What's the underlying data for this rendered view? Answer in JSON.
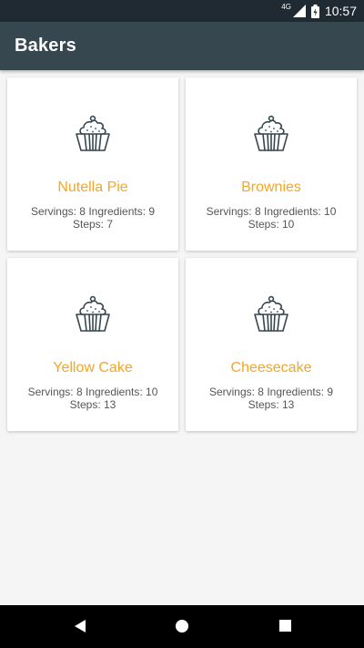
{
  "status_bar": {
    "network": "4G",
    "time": "10:57",
    "icons": [
      "signal-icon",
      "battery-icon"
    ]
  },
  "app_bar": {
    "title": "Bakers"
  },
  "recipes": [
    {
      "name": "Nutella Pie",
      "servings_text": "Servings: 8",
      "ingredients_text": "Ingredients: 9",
      "steps_text": "Steps: 7",
      "icon": "cupcake-icon"
    },
    {
      "name": "Brownies",
      "servings_text": "Servings: 8",
      "ingredients_text": "Ingredients: 10",
      "steps_text": "Steps: 10",
      "icon": "cupcake-icon"
    },
    {
      "name": "Yellow Cake",
      "servings_text": "Servings: 8",
      "ingredients_text": "Ingredients: 10",
      "steps_text": "Steps: 13",
      "icon": "cupcake-icon"
    },
    {
      "name": "Cheesecake",
      "servings_text": "Servings: 8",
      "ingredients_text": "Ingredients: 9",
      "steps_text": "Steps: 13",
      "icon": "cupcake-icon"
    }
  ],
  "nav_bar": {
    "icons": [
      "back-icon",
      "home-icon",
      "recents-icon"
    ]
  },
  "colors": {
    "status_bar": "#1f2a33",
    "app_bar": "#37474f",
    "accent": "#f5a623",
    "background": "#f5f5f5",
    "icon": "#37474f"
  }
}
